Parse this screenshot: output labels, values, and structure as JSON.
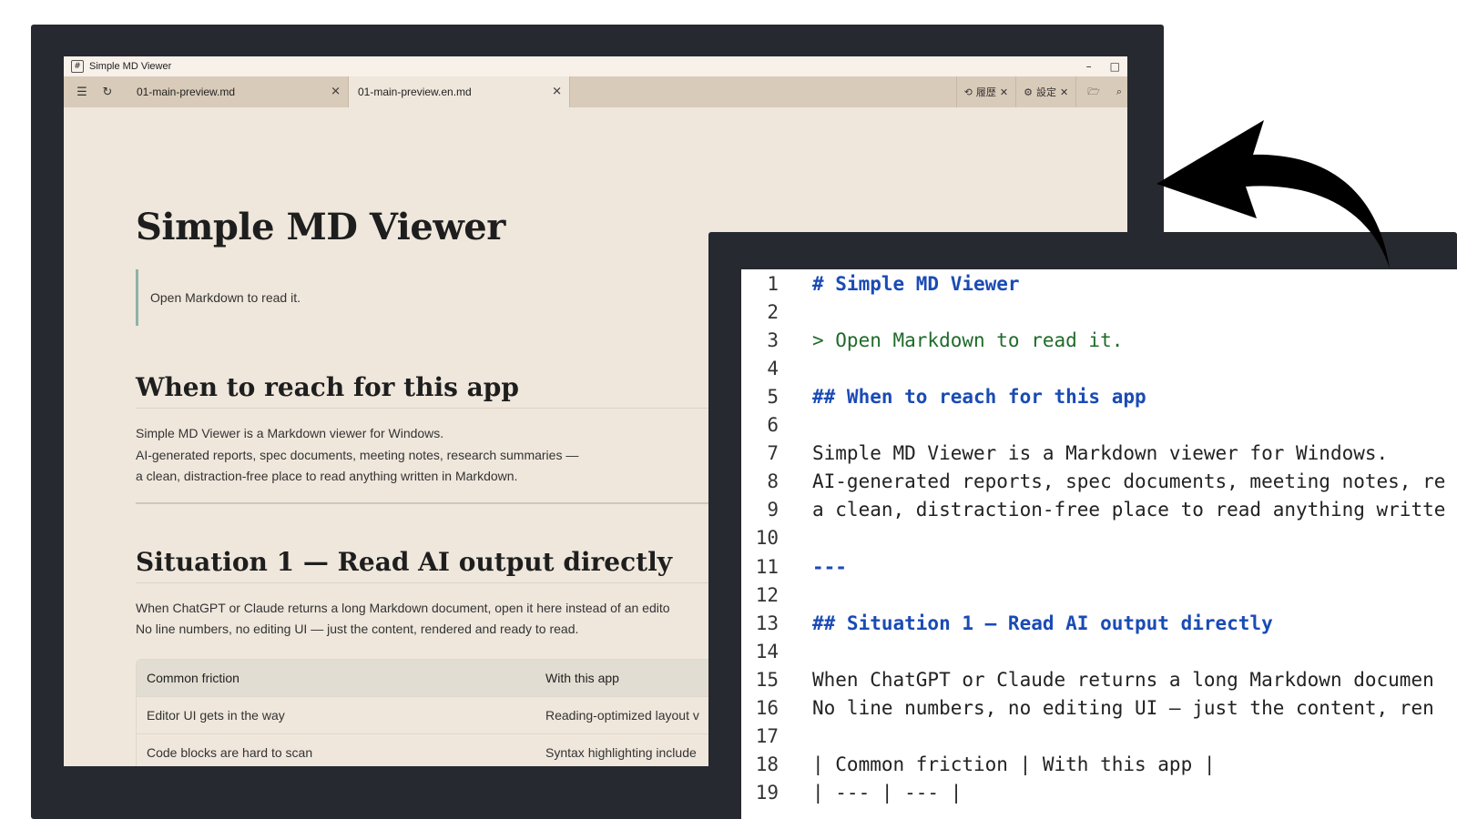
{
  "window": {
    "title": "Simple MD Viewer",
    "app_icon_glyph": "#",
    "minimize_glyph": "–",
    "maximize_glyph": "□"
  },
  "toolbar": {
    "outline_glyph": "☰",
    "reload_glyph": "↻",
    "tabs": [
      {
        "label": "01-main-preview.md",
        "close": "✕"
      },
      {
        "label": "01-main-preview.en.md",
        "close": "✕"
      }
    ],
    "history": {
      "icon": "⟲",
      "label": "履歴",
      "close": "✕"
    },
    "settings": {
      "icon": "⚙",
      "label": "設定",
      "close": "✕"
    },
    "open_folder_glyph": "🗁",
    "search_glyph": "⌕"
  },
  "document": {
    "title": "Simple MD Viewer",
    "quote": "Open Markdown to read it.",
    "h2_when": "When to reach for this app",
    "para_when": [
      "Simple MD Viewer is a Markdown viewer for Windows.",
      "AI-generated reports, spec documents, meeting notes, research summaries —",
      "a clean, distraction-free place to read anything written in Markdown."
    ],
    "h2_s1": "Situation 1 — Read AI output directly",
    "para_s1": [
      "When ChatGPT or Claude returns a long Markdown document, open it here instead of an edito",
      "No line numbers, no editing UI — just the content, rendered and ready to read."
    ],
    "table": {
      "headers": [
        "Common friction",
        "With this app"
      ],
      "rows": [
        [
          "Editor UI gets in the way",
          "Reading-optimized layout v"
        ],
        [
          "Code blocks are hard to scan",
          "Syntax highlighting include"
        ]
      ]
    }
  },
  "source": {
    "lines": [
      {
        "n": "1",
        "text": "# Simple MD Viewer",
        "kind": "h"
      },
      {
        "n": "2",
        "text": "",
        "kind": "t"
      },
      {
        "n": "3",
        "text": "> Open Markdown to read it.",
        "kind": "q"
      },
      {
        "n": "4",
        "text": "",
        "kind": "t"
      },
      {
        "n": "5",
        "text": "## When to reach for this app",
        "kind": "h"
      },
      {
        "n": "6",
        "text": "",
        "kind": "t"
      },
      {
        "n": "7",
        "text": "Simple MD Viewer is a Markdown viewer for Windows.",
        "kind": "t"
      },
      {
        "n": "8",
        "text": "AI-generated reports, spec documents, meeting notes, re",
        "kind": "t"
      },
      {
        "n": "9",
        "text": "a clean, distraction-free place to read anything writte",
        "kind": "t"
      },
      {
        "n": "10",
        "text": "",
        "kind": "t"
      },
      {
        "n": "11",
        "text": "---",
        "kind": "h"
      },
      {
        "n": "12",
        "text": "",
        "kind": "t"
      },
      {
        "n": "13",
        "text": "## Situation 1 — Read AI output directly",
        "kind": "h"
      },
      {
        "n": "14",
        "text": "",
        "kind": "t"
      },
      {
        "n": "15",
        "text": "When ChatGPT or Claude returns a long Markdown documen",
        "kind": "t"
      },
      {
        "n": "16",
        "text": "No line numbers, no editing UI — just the content, ren",
        "kind": "t"
      },
      {
        "n": "17",
        "text": "",
        "kind": "t"
      },
      {
        "n": "18",
        "text": "| Common friction | With this app |",
        "kind": "t"
      },
      {
        "n": "19",
        "text": "| --- | --- |",
        "kind": "t"
      }
    ]
  },
  "colors": {
    "bezel": "#26292f",
    "viewer_bg": "#efe7dc",
    "tabbar_bg": "#d9cbb9",
    "heading_blue": "#1a4bb5",
    "quote_green": "#1f6b2b"
  }
}
